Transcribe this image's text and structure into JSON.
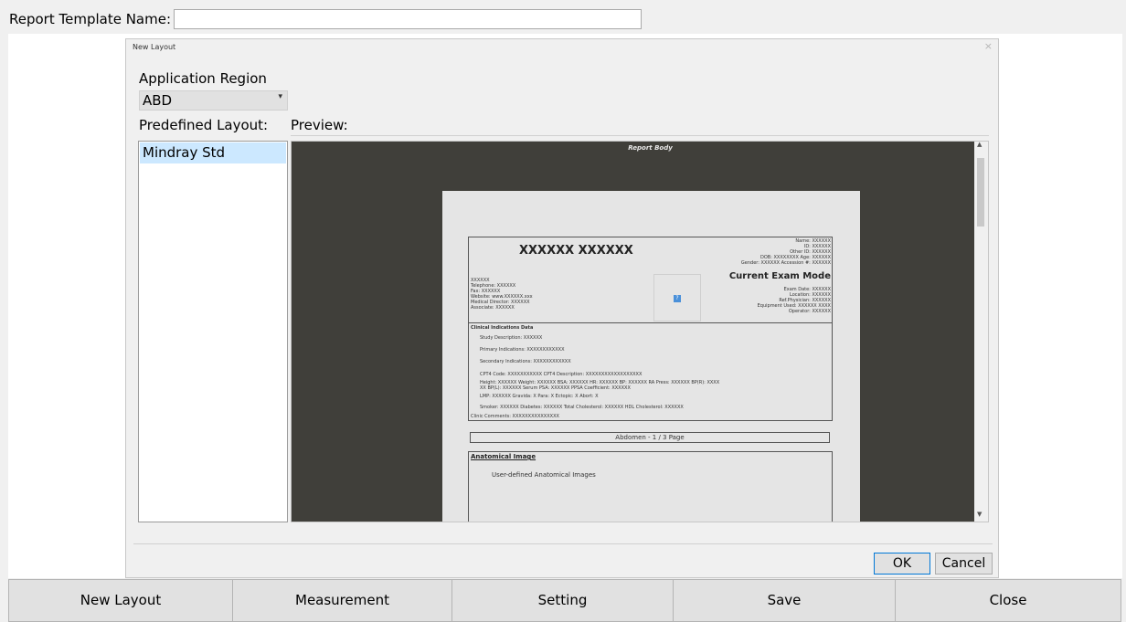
{
  "template": {
    "label": "Report Template Name:",
    "value": ""
  },
  "dialog": {
    "title": "New Layout",
    "close_glyph": "×",
    "region_label": "Application Region",
    "region_value": "ABD",
    "layout_label": "Predefined Layout:",
    "preview_label": "Preview:",
    "layouts": [
      "Mindray Std"
    ],
    "ok": "OK",
    "cancel": "Cancel"
  },
  "preview": {
    "report_body": "Report Body",
    "hospital_name": "XXXXXX XXXXXX",
    "patient_fields": [
      "Name: XXXXXX",
      "ID: XXXXXX",
      "Other ID: XXXXXX",
      "DOB: XXXXXXXX   Age: XXXXXX",
      "Gender: XXXXXX   Accession #: XXXXXX"
    ],
    "current_exam_mode": "Current Exam Mode",
    "exam_fields": [
      "Exam Date: XXXXXX",
      "Location: XXXXXX",
      "Ref.Physician: XXXXXX",
      "Equipment Used: XXXXXX XXXX",
      "Operator: XXXXXX"
    ],
    "contact_fields": [
      "XXXXXX",
      "Telephone: XXXXXX",
      "Fax: XXXXXX",
      "Website: www.XXXXXX.xxx",
      "Medical Director: XXXXXX",
      "Associate: XXXXXX"
    ],
    "clinical_title": "Clinical Indications Data",
    "clinical_lines": [
      "Study Description: XXXXXX",
      "Primary Indications: XXXXXXXXXXXX",
      "Secondary Indications: XXXXXXXXXXXX",
      "CPT4 Code: XXXXXXXXXXX   CPT4 Description: XXXXXXXXXXXXXXXXXX",
      "Height: XXXXXX   Weight: XXXXXX   BSA: XXXXXX   HR: XXXXXX   BP: XXXXXX   RA Press: XXXXXX   BP(R): XXXX",
      "XX   BP(L): XXXXXX   Serum PSA: XXXXXX   PPSA Coefficient: XXXXXX",
      "LMP: XXXXXX   Gravida: X   Para: X   Ectopic: X   Abort: X",
      "Smoker: XXXXXX   Diabetes: XXXXXX   Total Cholesterol: XXXXXX   HDL Cholesterol: XXXXXX",
      "Clinic Comments: XXXXXXXXXXXXXXX"
    ],
    "page_number": "Abdomen - 1 / 3 Page",
    "anatomical_title": "Anatomical Image",
    "anatomical_text": "User-defined Anatomical Images"
  },
  "bottom_bar": [
    "New Layout",
    "Measurement",
    "Setting",
    "Save",
    "Close"
  ]
}
